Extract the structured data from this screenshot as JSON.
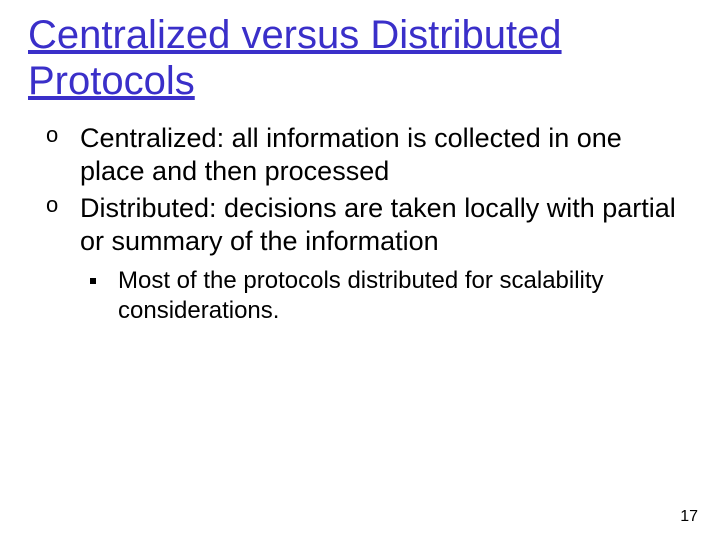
{
  "title": "Centralized versus Distributed Protocols",
  "bullets": [
    "Centralized: all information is collected in one place and then processed",
    "Distributed: decisions are taken locally with partial or summary of the information"
  ],
  "sub_bullets": [
    "Most of the protocols distributed for scalability considerations."
  ],
  "page_number": "17"
}
